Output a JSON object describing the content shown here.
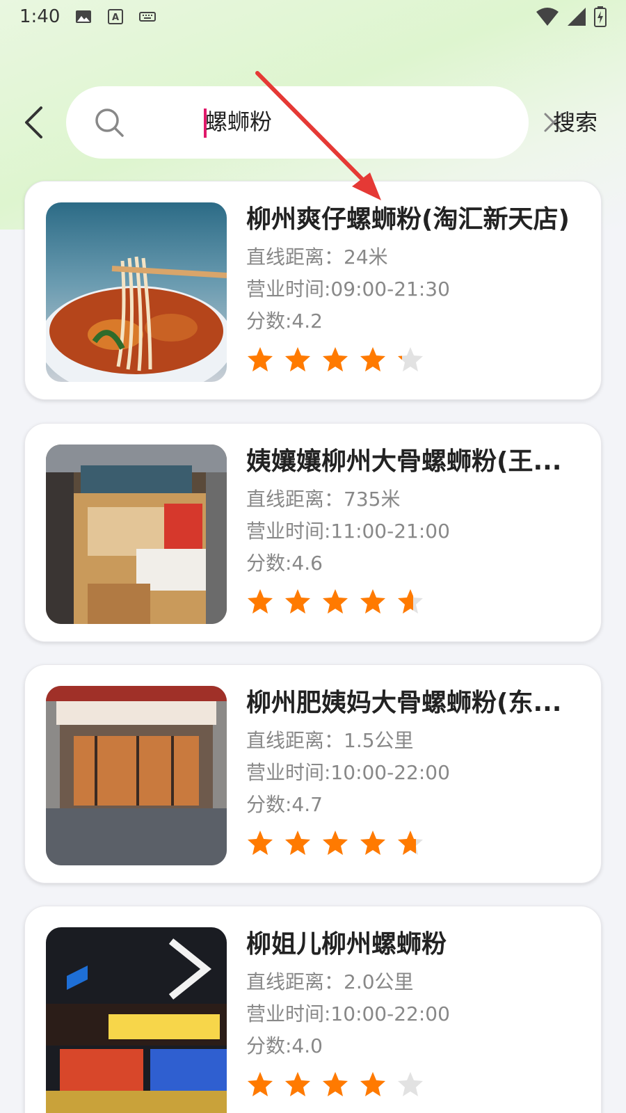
{
  "status_bar": {
    "time": "1:40",
    "icons": [
      "image-icon",
      "text-a-icon",
      "keyboard-icon"
    ],
    "right_icons": [
      "wifi-icon",
      "signal-icon",
      "battery-icon"
    ]
  },
  "search": {
    "value": "螺蛳粉",
    "button_label": "搜索"
  },
  "colors": {
    "star_filled": "#ff7a00",
    "star_empty": "#e2e2e2",
    "caret": "#e0196a",
    "arrow": "#e53935"
  },
  "results": [
    {
      "name": "柳州爽仔螺蛳粉(淘汇新天店)",
      "distance": "直线距离：24米",
      "hours": "营业时间:09:00-21:30",
      "score": "分数:4.2",
      "rating": 4.2,
      "image": "bowl-of-noodles-photo"
    },
    {
      "name": "姨孃孃柳州大骨螺蛳粉(王...",
      "distance": "直线距离：735米",
      "hours": "营业时间:11:00-21:00",
      "score": "分数:4.6",
      "rating": 4.6,
      "image": "storefront-photo"
    },
    {
      "name": "柳州肥姨妈大骨螺蛳粉(东...",
      "distance": "直线距离：1.5公里",
      "hours": "营业时间:10:00-22:00",
      "score": "分数:4.7",
      "rating": 4.7,
      "image": "storefront-photo"
    },
    {
      "name": "柳姐儿柳州螺蛳粉",
      "distance": "直线距离：2.0公里",
      "hours": "营业时间:10:00-22:00",
      "score": "分数:4.0",
      "rating": 4.0,
      "image": "storefront-photo"
    }
  ]
}
